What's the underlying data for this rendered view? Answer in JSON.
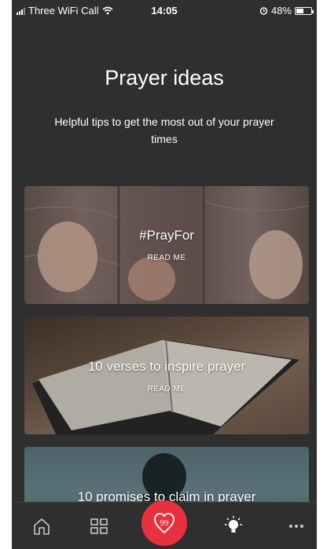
{
  "status_bar": {
    "carrier": "Three WiFi Call",
    "time": "14:05",
    "battery_percent": "48%",
    "battery_level": 0.48,
    "icons": [
      "signal-icon",
      "wifi-icon",
      "alarm-icon",
      "battery-icon"
    ]
  },
  "header": {
    "title": "Prayer ideas",
    "subtitle": "Helpful tips to get the most out of your prayer times"
  },
  "cards": [
    {
      "title": "#PrayFor",
      "cta": "READ ME"
    },
    {
      "title": "10 verses to inspire prayer",
      "cta": "READ ME"
    },
    {
      "title": "10 promises to claim in prayer"
    }
  ],
  "bottom_nav": {
    "items": [
      "home-icon",
      "grid-icon",
      "prayer-icon",
      "lightbulb-icon",
      "more-icon"
    ],
    "accent": "#e8313f"
  },
  "colors": {
    "background": "#2f2f2f",
    "text": "#ffffff",
    "accent": "#e8313f"
  }
}
